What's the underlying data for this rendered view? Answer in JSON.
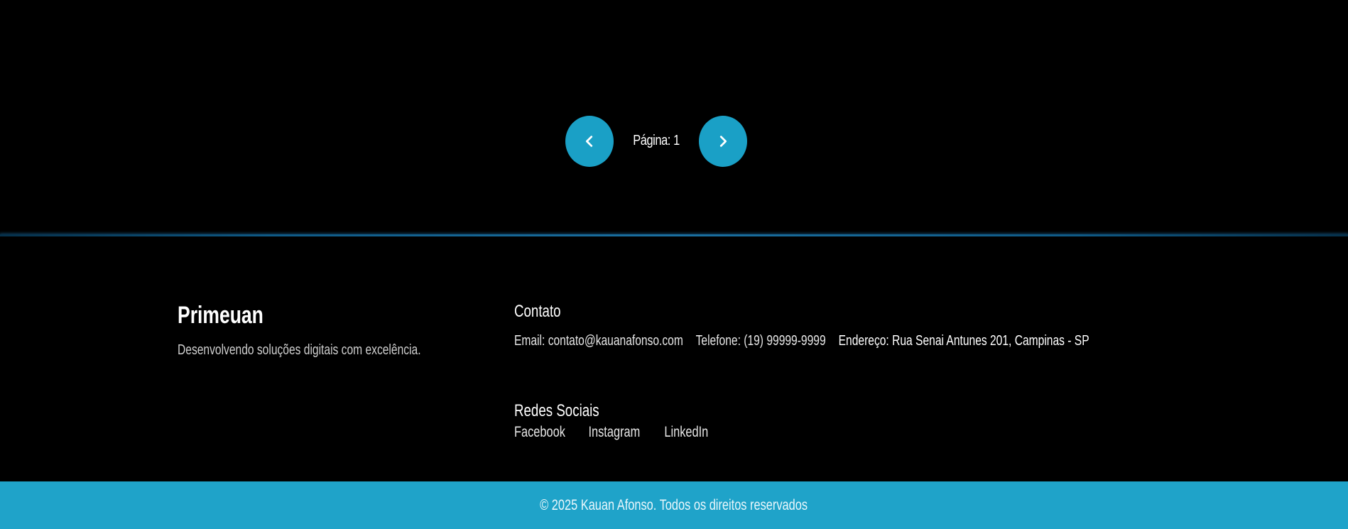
{
  "pagination": {
    "prev_icon": "chevron-left-icon",
    "next_icon": "chevron-right-icon",
    "label": "Página: 1",
    "accent": "#1aa0c6"
  },
  "footer": {
    "brand": {
      "title": "Primeuan",
      "description": "Desenvolvendo soluções digitais com excelência."
    },
    "contact": {
      "title": "Contato",
      "email_label": "Email:",
      "email": "contato@kauanafonso.com",
      "phone_label": "Telefone:",
      "phone": "(19) 99999-9999",
      "address_label": "Endereço:",
      "address": "Rua Senai Antunes 201, Campinas - SP"
    },
    "social": {
      "title": "Redes Sociais",
      "links": [
        "Facebook",
        "Instagram",
        "LinkedIn"
      ]
    }
  },
  "bottom_bar": {
    "copyright": "© 2025 Kauan Afonso. Todos os direitos reservados",
    "color": "#1fa3c9"
  }
}
